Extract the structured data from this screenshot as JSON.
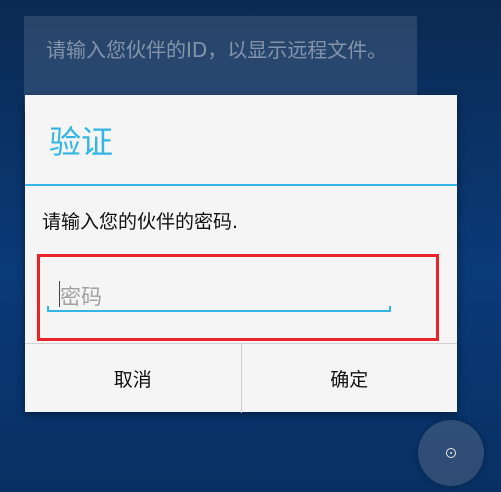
{
  "background": {
    "instruction_text": "请输入您伙伴的ID，以显示远程文件。"
  },
  "dialog": {
    "title": "验证",
    "message": "请输入您的伙伴的密码.",
    "password_placeholder": "密码",
    "password_value": "",
    "cancel_label": "取消",
    "confirm_label": "确定"
  },
  "colors": {
    "accent": "#33b5e5",
    "highlight": "#e8242a",
    "dialog_bg": "#f5f5f5"
  },
  "icons": {
    "fab": "target-dot-icon"
  }
}
